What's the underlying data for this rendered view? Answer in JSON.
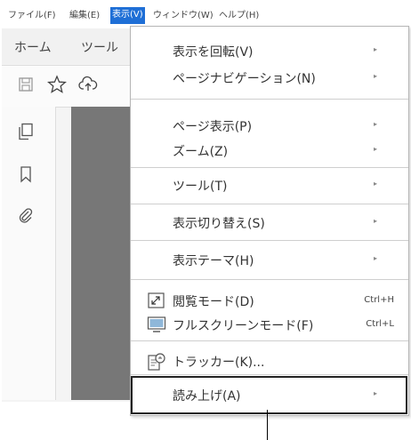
{
  "menubar": {
    "file": "ファイル(F)",
    "edit": "編集(E)",
    "view": "表示(V)",
    "window": "ウィンドウ(W)",
    "help": "ヘルプ(H)"
  },
  "tabs": {
    "home": "ホーム",
    "tools": "ツール"
  },
  "toolbar": {
    "icons": [
      "save-icon",
      "star-icon",
      "upload-cloud-icon"
    ]
  },
  "leftrail": {
    "icons": [
      "pages-icon",
      "bookmark-icon",
      "attachment-icon"
    ]
  },
  "view_menu": {
    "items": [
      {
        "label": "表示を回転(V)",
        "submenu": true
      },
      {
        "label": "ページナビゲーション(N)",
        "submenu": true
      },
      {
        "label": "ページ表示(P)",
        "submenu": true
      },
      {
        "label": "ズーム(Z)",
        "submenu": true
      },
      {
        "label": "ツール(T)",
        "submenu": true
      },
      {
        "label": "表示切り替え(S)",
        "submenu": true
      },
      {
        "label": "表示テーマ(H)",
        "submenu": true
      },
      {
        "label": "閲覧モード(D)",
        "shortcut": "Ctrl+H",
        "icon": "reading-mode-icon"
      },
      {
        "label": "フルスクリーンモード(F)",
        "shortcut": "Ctrl+L",
        "icon": "full-screen-icon"
      },
      {
        "label": "トラッカー(K)...",
        "icon": "tracker-icon"
      },
      {
        "label": "読み上げ(A)",
        "submenu": true
      }
    ],
    "arrow_glyph": "▸"
  },
  "colors": {
    "menubar_active": "#1f6fd6",
    "document_gray": "#777777",
    "highlight_border": "#222222"
  }
}
